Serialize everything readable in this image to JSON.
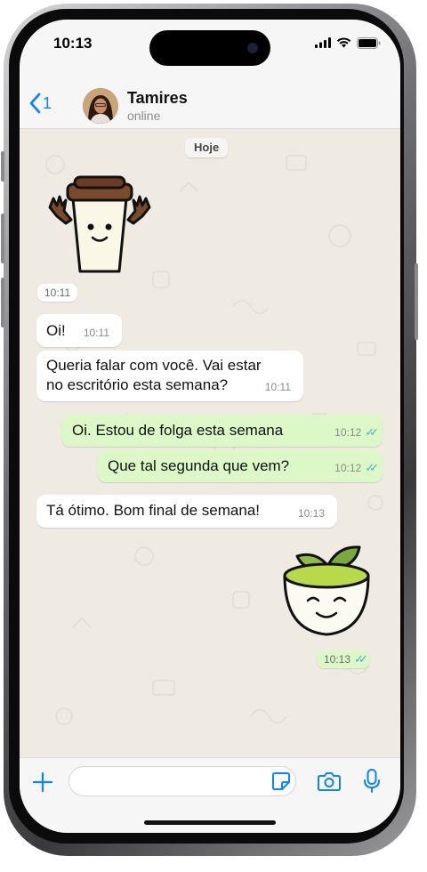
{
  "status_bar": {
    "time": "10:13"
  },
  "header": {
    "back_count": "1",
    "contact_name": "Tamires",
    "contact_status": "online"
  },
  "chat": {
    "date_chip": "Hoje",
    "sticker_coffee": {
      "icon": "coffee-cup-sticker",
      "time": "10:11"
    },
    "messages": [
      {
        "text": "Oi!",
        "time": "10:11",
        "direction": "incoming"
      },
      {
        "text_line1": "Queria falar com você. Vai estar",
        "text_line2": "no escritório esta semana?",
        "time": "10:11",
        "direction": "incoming"
      },
      {
        "text": "Oi. Estou de folga esta semana",
        "time": "10:12",
        "direction": "outgoing",
        "status": "read"
      },
      {
        "text": "Que tal segunda que vem?",
        "time": "10:12",
        "direction": "outgoing",
        "status": "read"
      },
      {
        "text": "Tá ótimo. Bom final de semana!",
        "time": "10:13",
        "direction": "incoming"
      }
    ],
    "sticker_tea": {
      "icon": "tea-cup-sticker",
      "time": "10:13",
      "status": "read"
    }
  },
  "composer": {
    "input_value": "",
    "input_placeholder": "",
    "icons": [
      "plus-icon",
      "sticker-icon",
      "camera-icon",
      "microphone-icon"
    ]
  },
  "colors": {
    "accent": "#0a84ff",
    "outgoing_bubble": "#dcf8c6",
    "incoming_bubble": "#ffffff",
    "chat_background": "#efeae2",
    "read_ticks": "#4fa7d7"
  }
}
